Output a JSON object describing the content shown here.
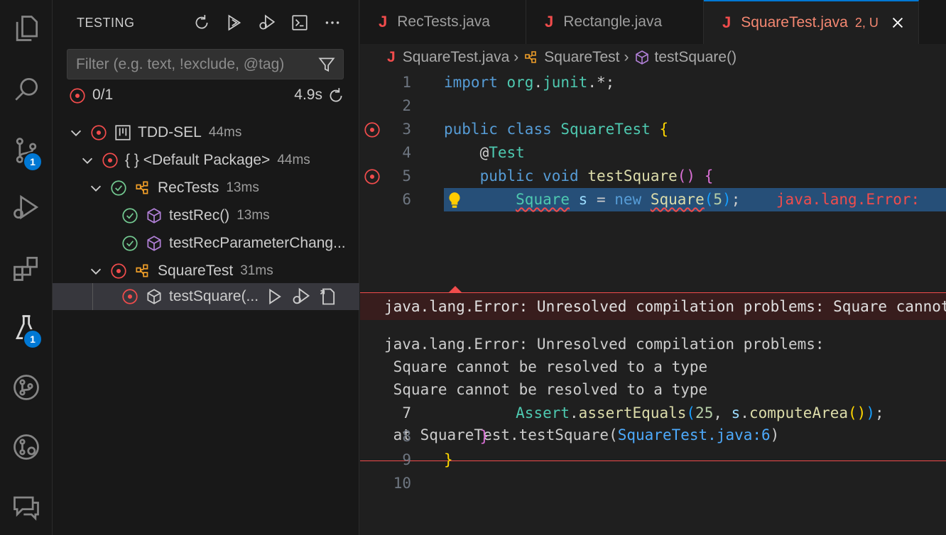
{
  "activity": {
    "items": [
      {
        "name": "explorer",
        "icon": "files-icon"
      },
      {
        "name": "search",
        "icon": "search-icon"
      },
      {
        "name": "source-control",
        "icon": "source-control-icon",
        "badge": "1"
      },
      {
        "name": "run-debug",
        "icon": "run-debug-icon"
      },
      {
        "name": "extensions",
        "icon": "extensions-icon"
      },
      {
        "name": "testing",
        "icon": "beaker-icon",
        "badge": "1"
      },
      {
        "name": "git-graph",
        "icon": "git-graph-icon"
      },
      {
        "name": "git-lens",
        "icon": "gitlens-icon"
      },
      {
        "name": "comments",
        "icon": "comments-icon"
      }
    ]
  },
  "sidebar": {
    "title": "TESTING",
    "filter_placeholder": "Filter (e.g. text, !exclude, @tag)",
    "summary": {
      "count": "0/1",
      "time": "4.9s"
    },
    "tree": [
      {
        "label": "TDD-SEL",
        "duration": "44ms",
        "status": "failed"
      },
      {
        "label": "{ }  <Default Package>",
        "duration": "44ms",
        "status": "failed"
      },
      {
        "label": "RecTests",
        "duration": "13ms",
        "status": "passed"
      },
      {
        "label": "testRec()",
        "duration": "13ms",
        "status": "passed"
      },
      {
        "label": "testRecParameterChang...",
        "duration": "",
        "status": "passed"
      },
      {
        "label": "SquareTest",
        "duration": "31ms",
        "status": "failed"
      },
      {
        "label": "testSquare(...",
        "duration": "",
        "status": "failed"
      }
    ]
  },
  "editor": {
    "tabs": [
      {
        "label": "RecTests.java",
        "badge": ""
      },
      {
        "label": "Rectangle.java",
        "badge": ""
      },
      {
        "label": "SquareTest.java",
        "badge": "2, U"
      }
    ],
    "breadcrumb": {
      "file": "SquareTest.java",
      "cls": "SquareTest",
      "method": "testSquare()"
    },
    "line_numbers": [
      "1",
      "2",
      "3",
      "4",
      "5",
      "6",
      "7",
      "8",
      "9",
      "10"
    ],
    "inline_error": "java.lang.Error:",
    "peek": {
      "header": "java.lang.Error: Unresolved compilation problems: Square cannot be resolved to a type",
      "line1": "java.lang.Error: Unresolved compilation problems:",
      "line2": " Square cannot be resolved to a type",
      "line3": " Square cannot be resolved to a type",
      "at_prefix": " at SquareTest.testSquare(",
      "link": "SquareTest.java:6",
      "at_suffix": ")"
    }
  },
  "colors": {
    "accent": "#0078d4",
    "error": "#f14c4c",
    "passed": "#73c991"
  }
}
